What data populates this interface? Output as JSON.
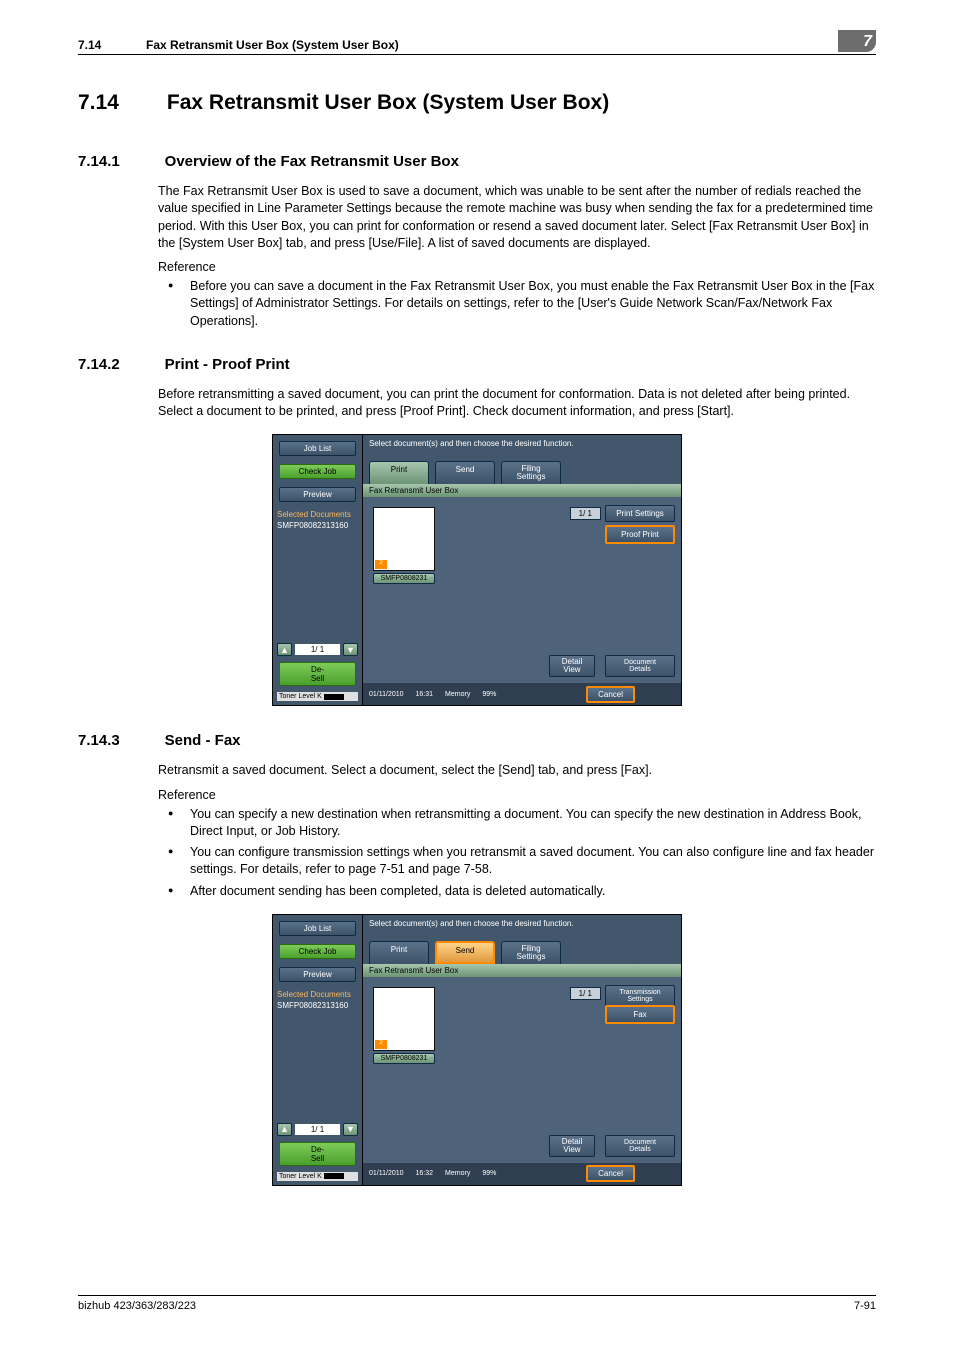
{
  "header": {
    "num": "7.14",
    "title": "Fax Retransmit User Box (System User Box)",
    "chapter": "7"
  },
  "h1": {
    "num": "7.14",
    "title": "Fax Retransmit User Box (System User Box)"
  },
  "s1": {
    "num": "7.14.1",
    "title": "Overview of the Fax Retransmit User Box",
    "p": "The Fax Retransmit User Box is used to save a document, which was unable to be sent after the number of redials reached the value specified in Line Parameter Settings because the remote machine was busy when sending the fax for a predetermined time period. With this User Box, you can print for conformation or resend a saved document later. Select [Fax Retransmit User Box] in the [System User Box] tab, and press [Use/File]. A list of saved documents are displayed.",
    "ref_label": "Reference",
    "ref": [
      "Before you can save a document in the Fax Retransmit User Box, you must enable the Fax Retransmit User Box in the [Fax Settings] of Administrator Settings. For details on settings, refer to the [User's Guide Network Scan/Fax/Network Fax Operations]."
    ]
  },
  "s2": {
    "num": "7.14.2",
    "title": "Print - Proof Print",
    "p": "Before retransmitting a saved document, you can print the document for conformation. Data is not deleted after being printed. Select a document to be printed, and press [Proof Print]. Check document information, and press [Start]."
  },
  "s3": {
    "num": "7.14.3",
    "title": "Send - Fax",
    "p": "Retransmit a saved document. Select a document, select the [Send] tab, and press [Fax].",
    "ref_label": "Reference",
    "ref": [
      "You can specify a new destination when retransmitting a document. You can specify the new destination in Address Book, Direct Input, or Job History.",
      "You can configure transmission settings when you retransmit a saved document. You can also configure line and fax header settings. For details, refer to page 7-51 and page 7-58.",
      "After document sending has been completed, data is deleted automatically."
    ]
  },
  "mock_common": {
    "instruction": "Select document(s) and then choose the desired function.",
    "job_list": "Job List",
    "check_job": "Check Job",
    "preview": "Preview",
    "sel_label": "Selected Documents",
    "sel_doc": "SMFP08082313160",
    "page_small": "1/  1",
    "deselect": "De-\nSell",
    "toner": "Toner Level  K",
    "tab_print": "Print",
    "tab_send": "Send",
    "tab_filing": "Filing\nSettings",
    "crumb": "Fax Retransmit User Box",
    "thumb_label": "SMFP0808231",
    "thumb_badge": "2",
    "pg_ind": "1/  1",
    "detail_view": "Detail\nView",
    "doc_details": "Document\nDetails",
    "cancel": "Cancel",
    "memory": "Memory",
    "mempct": "99%"
  },
  "mock1": {
    "btn1": "Print Settings",
    "btn2": "Proof Print",
    "date": "01/11/2010",
    "time": "16:31"
  },
  "mock2": {
    "btn1": "Transmission\nSettings",
    "btn2": "Fax",
    "date": "01/11/2010",
    "time": "16:32"
  },
  "footer": {
    "left": "bizhub 423/363/283/223",
    "right": "7-91"
  }
}
